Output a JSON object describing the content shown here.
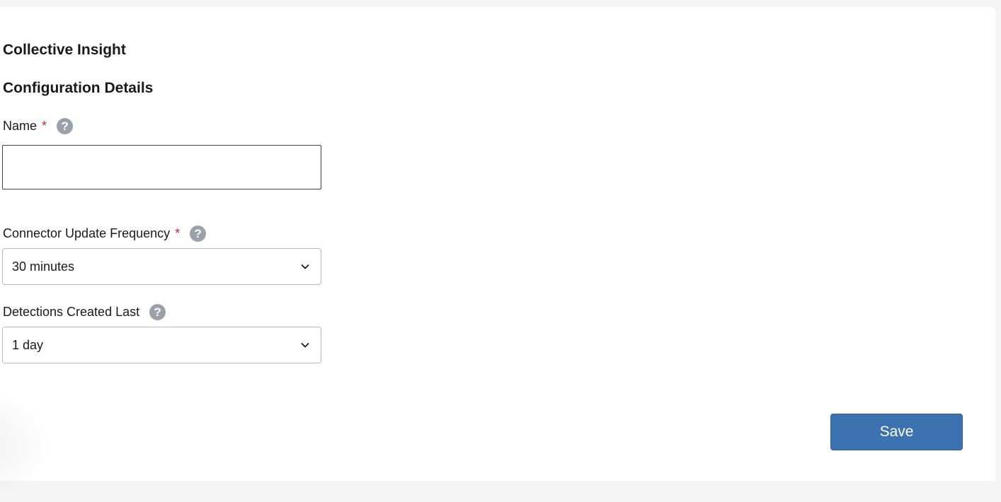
{
  "header": {
    "app_title": "Collective Insight",
    "section_title": "Configuration Details"
  },
  "fields": {
    "name": {
      "label": "Name",
      "required_marker": "*",
      "help_icon": "question-circle-icon",
      "value": "",
      "placeholder": ""
    },
    "update_frequency": {
      "label": "Connector Update Frequency",
      "required_marker": "*",
      "help_icon": "question-circle-icon",
      "selected": "30 minutes"
    },
    "detections_created_last": {
      "label": "Detections Created Last",
      "help_icon": "question-circle-icon",
      "selected": "1 day"
    }
  },
  "actions": {
    "save_label": "Save"
  },
  "colors": {
    "primary_button": "#3d72b1",
    "required_marker": "#c62828",
    "help_icon": "#9aa1a8"
  }
}
